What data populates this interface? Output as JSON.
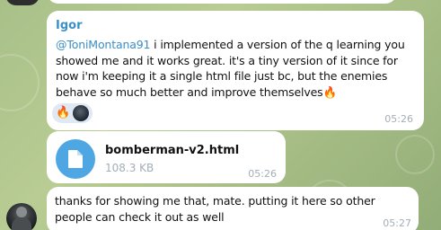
{
  "chat": {
    "messages": [
      {
        "sender": "Igor",
        "mention": "@ToniMontana91",
        "text": " i implemented a version of the q learning you showed me and it works great. it's a tiny version of it since for now i'm keeping it a single html file just bc, but the enemies behave so much better and improve themselves🔥",
        "reactions": [
          "🔥"
        ],
        "time": "05:26"
      },
      {
        "file_name": "bomberman-v2.html",
        "file_size": "108.3 KB",
        "time": "05:26"
      },
      {
        "text": "thanks for showing me that, mate. putting it here so other people can check it out as well",
        "time": "05:27"
      }
    ]
  },
  "colors": {
    "accent": "#3a8fc7",
    "file_icon_bg": "#4ea7e3",
    "time_text": "#a3aeb8"
  },
  "icons": {
    "file": "document-icon",
    "reaction": "fire-emoji"
  }
}
